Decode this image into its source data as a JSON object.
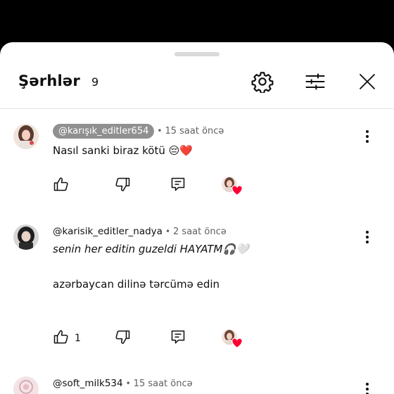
{
  "header": {
    "title": "Şərhlər",
    "count": "9"
  },
  "comments": [
    {
      "handle": "@karışık_editler654",
      "separator": "•",
      "time": "15 saat öncə",
      "text": "Nasıl sanki biraz kötü 😔❤️",
      "likes": ""
    },
    {
      "handle": "@karisik_editler_nadya",
      "separator": "•",
      "time": "2 saat öncə",
      "text_line1": "senin her editin guzeldi HAYATM🎧🤍",
      "text_line2": "azərbaycan dilinə tərcümə edin",
      "likes": "1"
    },
    {
      "handle": "@soft_milk534",
      "separator": "•",
      "time": "15 saat öncə"
    }
  ],
  "icons": {
    "settings": "gear-icon",
    "sort": "sliders-icon",
    "close": "close-icon",
    "like": "thumbs-up-icon",
    "dislike": "thumbs-down-icon",
    "reply": "reply-icon",
    "more": "more-vertical-icon",
    "heart": "creator-heart-icon"
  },
  "colors": {
    "heart": "#ff0033",
    "pill": "#909090"
  }
}
